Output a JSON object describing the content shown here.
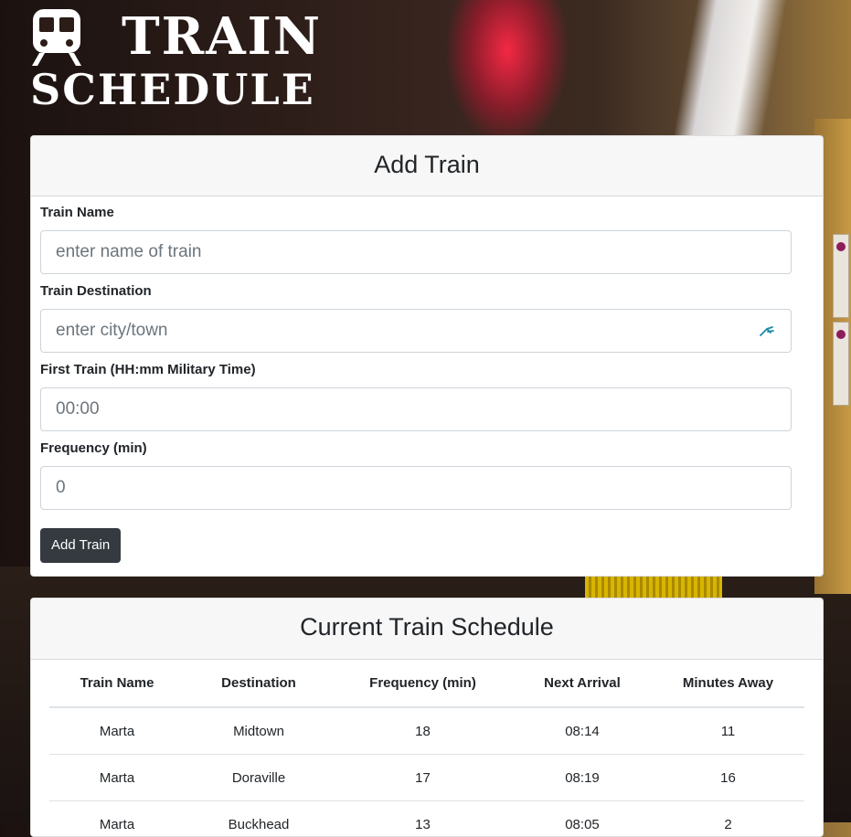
{
  "header": {
    "title_line1": "TRAIN",
    "title_line2": "SCHEDULE",
    "logo_icon": "train-icon"
  },
  "add_train": {
    "title": "Add Train",
    "fields": [
      {
        "label": "Train Name",
        "placeholder": "enter name of train"
      },
      {
        "label": "Train Destination",
        "placeholder": "enter city/town"
      },
      {
        "label": "First Train (HH:mm Military Time)",
        "placeholder": "00:00"
      },
      {
        "label": "Frequency (min)",
        "placeholder": "0"
      }
    ],
    "submit_label": "Add Train"
  },
  "schedule": {
    "title": "Current Train Schedule",
    "columns": [
      "Train Name",
      "Destination",
      "Frequency (min)",
      "Next Arrival",
      "Minutes Away"
    ],
    "rows": [
      [
        "Marta",
        "Midtown",
        "18",
        "08:14",
        "11"
      ],
      [
        "Marta",
        "Doraville",
        "17",
        "08:19",
        "16"
      ],
      [
        "Marta",
        "Buckhead",
        "13",
        "08:05",
        "2"
      ]
    ]
  },
  "colors": {
    "button_bg": "#343a40",
    "card_header_bg": "#f7f7f7",
    "platform_stripe": "#d9b400"
  }
}
